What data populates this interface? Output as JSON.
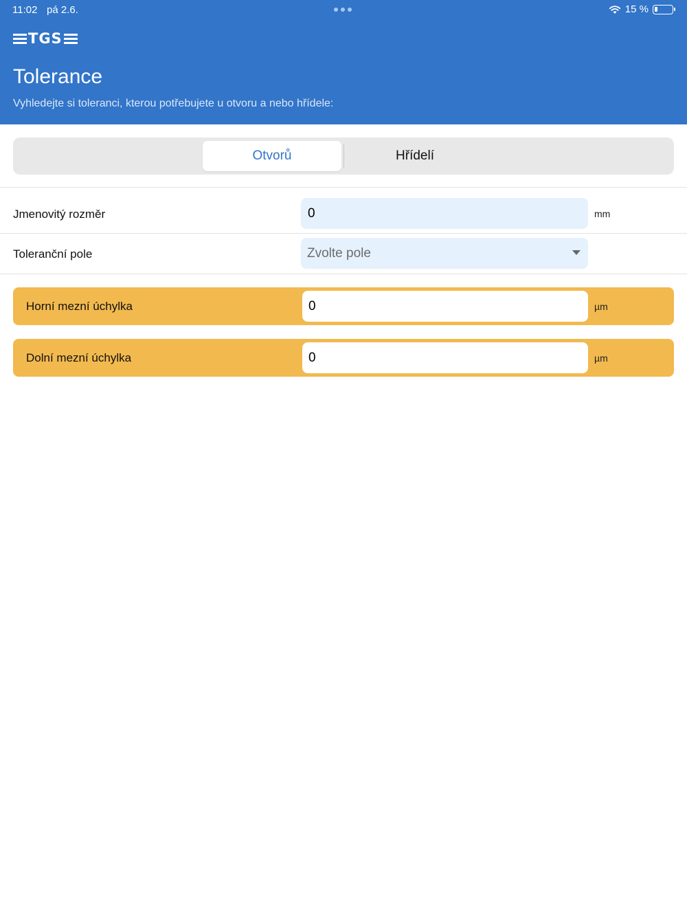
{
  "status_bar": {
    "time": "11:02",
    "date": "pá 2.6.",
    "battery": "15 %",
    "battery_level_percent": 15
  },
  "header": {
    "logo": "TGS",
    "title": "Tolerance",
    "subtitle": "Vyhledejte si toleranci, kterou potřebujete u otvoru a nebo hřídele:"
  },
  "tabs": [
    {
      "label": "Otvorů",
      "active": true
    },
    {
      "label": "Hřídelí",
      "active": false
    }
  ],
  "form": {
    "nominal_size": {
      "label": "Jmenovitý rozměr",
      "value": "0",
      "unit": "mm"
    },
    "tolerance_field": {
      "label": "Toleranční pole",
      "placeholder": "Zvolte pole"
    }
  },
  "results": {
    "upper_deviation": {
      "label": "Horní mezní úchylka",
      "value": "0",
      "unit": "µm"
    },
    "lower_deviation": {
      "label": "Dolní mezní úchylka",
      "value": "0",
      "unit": "µm"
    }
  },
  "colors": {
    "header_blue": "#3275c9",
    "result_orange": "#f2b94e",
    "input_blue": "#e5f1fc",
    "active_tab_text": "#3275c9"
  },
  "icons": [
    "wifi-icon",
    "battery-icon",
    "multitasking-dots-icon",
    "chevron-down-icon"
  ]
}
